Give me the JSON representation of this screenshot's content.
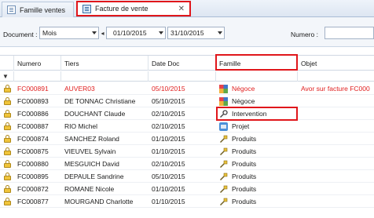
{
  "tabs": [
    {
      "label": "Famille ventes",
      "icon": "document-list-icon",
      "active": false
    },
    {
      "label": "Facture de vente",
      "icon": "invoice-icon",
      "active": true
    }
  ],
  "filters": {
    "document_label": "Document :",
    "period_value": "Mois",
    "date_from": "01/10/2015",
    "date_to": "31/10/2015",
    "numero_label": "Numero :",
    "numero_value": ""
  },
  "columns": [
    "Numero",
    "Tiers",
    "Date Doc",
    "Famille",
    "Objet"
  ],
  "rows": [
    {
      "numero": "FC000891",
      "tiers": "AUVER03",
      "date": "05/10/2015",
      "famille": "Négoce",
      "famille_icon": "negoce",
      "objet": "Avor sur facture FC000",
      "highlight": true
    },
    {
      "numero": "FC000893",
      "tiers": "DE TONNAC Christiane",
      "date": "05/10/2015",
      "famille": "Négoce",
      "famille_icon": "negoce",
      "objet": "",
      "highlight": false
    },
    {
      "numero": "FC000886",
      "tiers": "DOUCHANT Claude",
      "date": "02/10/2015",
      "famille": "Intervention",
      "famille_icon": "intervention",
      "objet": "",
      "highlight": false
    },
    {
      "numero": "FC000887",
      "tiers": "RIO Michel",
      "date": "02/10/2015",
      "famille": "Projet",
      "famille_icon": "projet",
      "objet": "",
      "highlight": false
    },
    {
      "numero": "FC000874",
      "tiers": "SANCHEZ Roland",
      "date": "01/10/2015",
      "famille": "Produits",
      "famille_icon": "produits",
      "objet": "",
      "highlight": false
    },
    {
      "numero": "FC000875",
      "tiers": "VIEUVEL Sylvain",
      "date": "01/10/2015",
      "famille": "Produits",
      "famille_icon": "produits",
      "objet": "",
      "highlight": false
    },
    {
      "numero": "FC000880",
      "tiers": "MESGUICH David",
      "date": "02/10/2015",
      "famille": "Produits",
      "famille_icon": "produits",
      "objet": "",
      "highlight": false
    },
    {
      "numero": "FC000895",
      "tiers": "DEPAULE Sandrine",
      "date": "05/10/2015",
      "famille": "Produits",
      "famille_icon": "produits",
      "objet": "",
      "highlight": false
    },
    {
      "numero": "FC000872",
      "tiers": "ROMANE Nicole",
      "date": "01/10/2015",
      "famille": "Produits",
      "famille_icon": "produits",
      "objet": "",
      "highlight": false
    },
    {
      "numero": "FC000877",
      "tiers": "MOURGAND Charlotte",
      "date": "01/10/2015",
      "famille": "Produits",
      "famille_icon": "produits",
      "objet": "",
      "highlight": false
    }
  ],
  "colors": {
    "highlight_text": "#e01f1f",
    "annotation_box": "#e0161b"
  }
}
